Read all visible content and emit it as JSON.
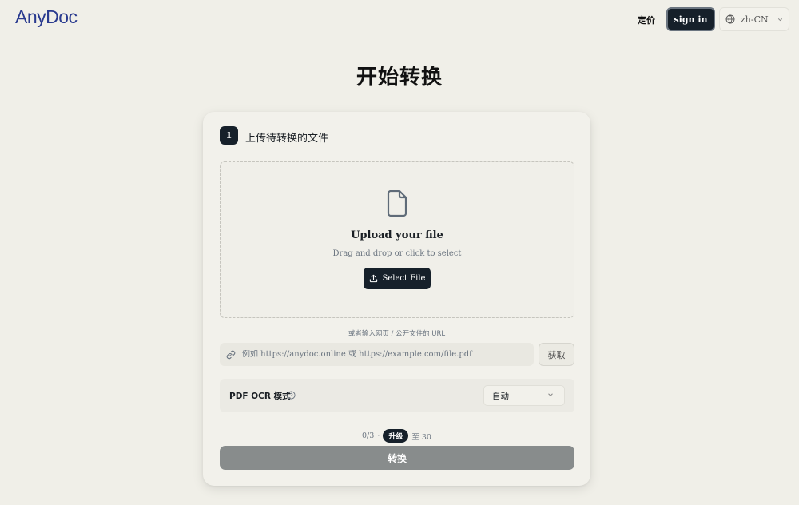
{
  "header": {
    "logo": "AnyDoc",
    "pricing": "定价",
    "sign_in": "sign in",
    "language": "zh-CN"
  },
  "page_title": "开始转换",
  "step": {
    "number": "1",
    "title": "上传待转换的文件"
  },
  "dropzone": {
    "title": "Upload your file",
    "subtitle": "Drag and drop or click to select",
    "button": "Select File"
  },
  "url": {
    "label": "或者输入网页 / 公开文件的 URL",
    "placeholder": "例如 https://anydoc.online 或 https://example.com/file.pdf",
    "fetch": "获取"
  },
  "ocr": {
    "label": "PDF OCR 模式",
    "selected": "自动"
  },
  "quota": {
    "used": "0/3",
    "separator": "·",
    "upgrade": "升级",
    "limit": "至 30"
  },
  "convert": "转换",
  "icons": {
    "globe": "globe-icon",
    "chevron": "chevron-down-icon",
    "file": "file-icon",
    "upload": "upload-icon",
    "link": "link-icon",
    "help": "help-circle-icon"
  },
  "colors": {
    "background": "#f0efe8",
    "primary": "#16202a",
    "logo": "#2a3b8f",
    "disabled_button": "#888c8c"
  }
}
